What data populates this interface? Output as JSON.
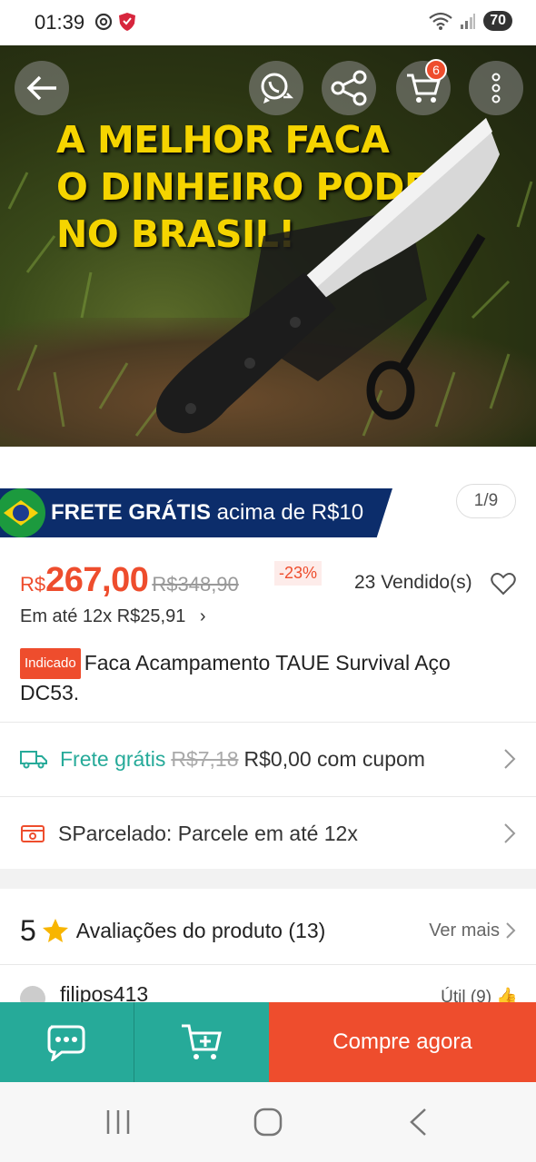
{
  "status_bar": {
    "time": "01:39",
    "battery": "70"
  },
  "hero": {
    "headline": [
      "A MELHOR FACA",
      "O DINHEIRO PODE",
      "NO BRASIL!"
    ]
  },
  "top_bar": {
    "cart_count": "6"
  },
  "banner": {
    "free_shipping_bold": "FRETE GRÁTIS",
    "free_shipping_rest": " acima de R$10"
  },
  "gallery": {
    "pager": "1/9"
  },
  "price": {
    "currency": "R$",
    "current": "267,00",
    "original": "R$348,90",
    "discount": "-23%",
    "sold": "23 Vendido(s)",
    "installments_prefix": "Em até ",
    "installments_value": "12x R$25,91",
    "installments_chevron": "›"
  },
  "product": {
    "tag": "Indicado",
    "title": "Faca Acampamento TAUE Survival Aço DC53."
  },
  "shipping": {
    "label": "Frete grátis",
    "original": "R$7,18",
    "coupon": "R$0,00 com cupom"
  },
  "installment_plan": {
    "label": "SParcelado: Parcele em até 12x"
  },
  "reviews": {
    "rating": "5",
    "title": "Avaliações do produto",
    "count": "(13)",
    "see_more": "Ver mais"
  },
  "first_review": {
    "username": "filipos413",
    "useful": "Útil (9)"
  },
  "bottom_bar": {
    "buy_now": "Compre agora"
  },
  "colors": {
    "accent": "#ee4d2d",
    "teal": "#26aa99",
    "banner_blue": "#0c2d6b",
    "headline_yellow": "#f5d400"
  }
}
